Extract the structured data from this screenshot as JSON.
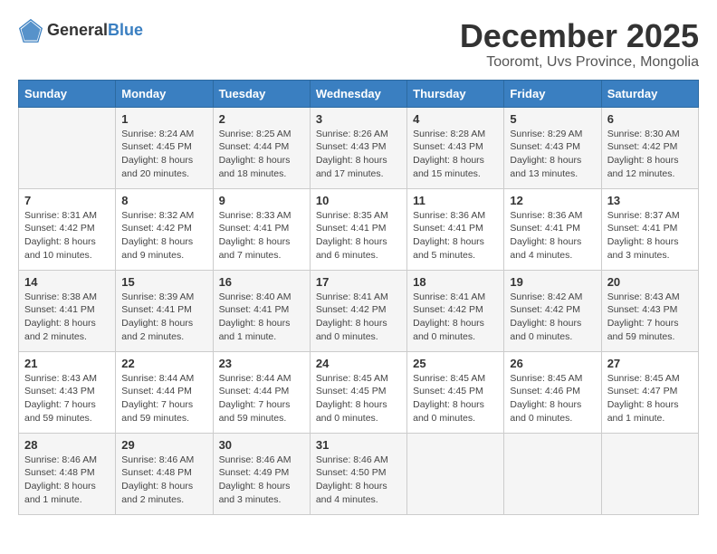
{
  "logo": {
    "general": "General",
    "blue": "Blue"
  },
  "title": "December 2025",
  "location": "Tooromt, Uvs Province, Mongolia",
  "days_of_week": [
    "Sunday",
    "Monday",
    "Tuesday",
    "Wednesday",
    "Thursday",
    "Friday",
    "Saturday"
  ],
  "weeks": [
    [
      {
        "day": "",
        "sunrise": "",
        "sunset": "",
        "daylight": ""
      },
      {
        "day": "1",
        "sunrise": "Sunrise: 8:24 AM",
        "sunset": "Sunset: 4:45 PM",
        "daylight": "Daylight: 8 hours and 20 minutes."
      },
      {
        "day": "2",
        "sunrise": "Sunrise: 8:25 AM",
        "sunset": "Sunset: 4:44 PM",
        "daylight": "Daylight: 8 hours and 18 minutes."
      },
      {
        "day": "3",
        "sunrise": "Sunrise: 8:26 AM",
        "sunset": "Sunset: 4:43 PM",
        "daylight": "Daylight: 8 hours and 17 minutes."
      },
      {
        "day": "4",
        "sunrise": "Sunrise: 8:28 AM",
        "sunset": "Sunset: 4:43 PM",
        "daylight": "Daylight: 8 hours and 15 minutes."
      },
      {
        "day": "5",
        "sunrise": "Sunrise: 8:29 AM",
        "sunset": "Sunset: 4:43 PM",
        "daylight": "Daylight: 8 hours and 13 minutes."
      },
      {
        "day": "6",
        "sunrise": "Sunrise: 8:30 AM",
        "sunset": "Sunset: 4:42 PM",
        "daylight": "Daylight: 8 hours and 12 minutes."
      }
    ],
    [
      {
        "day": "7",
        "sunrise": "Sunrise: 8:31 AM",
        "sunset": "Sunset: 4:42 PM",
        "daylight": "Daylight: 8 hours and 10 minutes."
      },
      {
        "day": "8",
        "sunrise": "Sunrise: 8:32 AM",
        "sunset": "Sunset: 4:42 PM",
        "daylight": "Daylight: 8 hours and 9 minutes."
      },
      {
        "day": "9",
        "sunrise": "Sunrise: 8:33 AM",
        "sunset": "Sunset: 4:41 PM",
        "daylight": "Daylight: 8 hours and 7 minutes."
      },
      {
        "day": "10",
        "sunrise": "Sunrise: 8:35 AM",
        "sunset": "Sunset: 4:41 PM",
        "daylight": "Daylight: 8 hours and 6 minutes."
      },
      {
        "day": "11",
        "sunrise": "Sunrise: 8:36 AM",
        "sunset": "Sunset: 4:41 PM",
        "daylight": "Daylight: 8 hours and 5 minutes."
      },
      {
        "day": "12",
        "sunrise": "Sunrise: 8:36 AM",
        "sunset": "Sunset: 4:41 PM",
        "daylight": "Daylight: 8 hours and 4 minutes."
      },
      {
        "day": "13",
        "sunrise": "Sunrise: 8:37 AM",
        "sunset": "Sunset: 4:41 PM",
        "daylight": "Daylight: 8 hours and 3 minutes."
      }
    ],
    [
      {
        "day": "14",
        "sunrise": "Sunrise: 8:38 AM",
        "sunset": "Sunset: 4:41 PM",
        "daylight": "Daylight: 8 hours and 2 minutes."
      },
      {
        "day": "15",
        "sunrise": "Sunrise: 8:39 AM",
        "sunset": "Sunset: 4:41 PM",
        "daylight": "Daylight: 8 hours and 2 minutes."
      },
      {
        "day": "16",
        "sunrise": "Sunrise: 8:40 AM",
        "sunset": "Sunset: 4:41 PM",
        "daylight": "Daylight: 8 hours and 1 minute."
      },
      {
        "day": "17",
        "sunrise": "Sunrise: 8:41 AM",
        "sunset": "Sunset: 4:42 PM",
        "daylight": "Daylight: 8 hours and 0 minutes."
      },
      {
        "day": "18",
        "sunrise": "Sunrise: 8:41 AM",
        "sunset": "Sunset: 4:42 PM",
        "daylight": "Daylight: 8 hours and 0 minutes."
      },
      {
        "day": "19",
        "sunrise": "Sunrise: 8:42 AM",
        "sunset": "Sunset: 4:42 PM",
        "daylight": "Daylight: 8 hours and 0 minutes."
      },
      {
        "day": "20",
        "sunrise": "Sunrise: 8:43 AM",
        "sunset": "Sunset: 4:43 PM",
        "daylight": "Daylight: 7 hours and 59 minutes."
      }
    ],
    [
      {
        "day": "21",
        "sunrise": "Sunrise: 8:43 AM",
        "sunset": "Sunset: 4:43 PM",
        "daylight": "Daylight: 7 hours and 59 minutes."
      },
      {
        "day": "22",
        "sunrise": "Sunrise: 8:44 AM",
        "sunset": "Sunset: 4:44 PM",
        "daylight": "Daylight: 7 hours and 59 minutes."
      },
      {
        "day": "23",
        "sunrise": "Sunrise: 8:44 AM",
        "sunset": "Sunset: 4:44 PM",
        "daylight": "Daylight: 7 hours and 59 minutes."
      },
      {
        "day": "24",
        "sunrise": "Sunrise: 8:45 AM",
        "sunset": "Sunset: 4:45 PM",
        "daylight": "Daylight: 8 hours and 0 minutes."
      },
      {
        "day": "25",
        "sunrise": "Sunrise: 8:45 AM",
        "sunset": "Sunset: 4:45 PM",
        "daylight": "Daylight: 8 hours and 0 minutes."
      },
      {
        "day": "26",
        "sunrise": "Sunrise: 8:45 AM",
        "sunset": "Sunset: 4:46 PM",
        "daylight": "Daylight: 8 hours and 0 minutes."
      },
      {
        "day": "27",
        "sunrise": "Sunrise: 8:45 AM",
        "sunset": "Sunset: 4:47 PM",
        "daylight": "Daylight: 8 hours and 1 minute."
      }
    ],
    [
      {
        "day": "28",
        "sunrise": "Sunrise: 8:46 AM",
        "sunset": "Sunset: 4:48 PM",
        "daylight": "Daylight: 8 hours and 1 minute."
      },
      {
        "day": "29",
        "sunrise": "Sunrise: 8:46 AM",
        "sunset": "Sunset: 4:48 PM",
        "daylight": "Daylight: 8 hours and 2 minutes."
      },
      {
        "day": "30",
        "sunrise": "Sunrise: 8:46 AM",
        "sunset": "Sunset: 4:49 PM",
        "daylight": "Daylight: 8 hours and 3 minutes."
      },
      {
        "day": "31",
        "sunrise": "Sunrise: 8:46 AM",
        "sunset": "Sunset: 4:50 PM",
        "daylight": "Daylight: 8 hours and 4 minutes."
      },
      {
        "day": "",
        "sunrise": "",
        "sunset": "",
        "daylight": ""
      },
      {
        "day": "",
        "sunrise": "",
        "sunset": "",
        "daylight": ""
      },
      {
        "day": "",
        "sunrise": "",
        "sunset": "",
        "daylight": ""
      }
    ]
  ]
}
